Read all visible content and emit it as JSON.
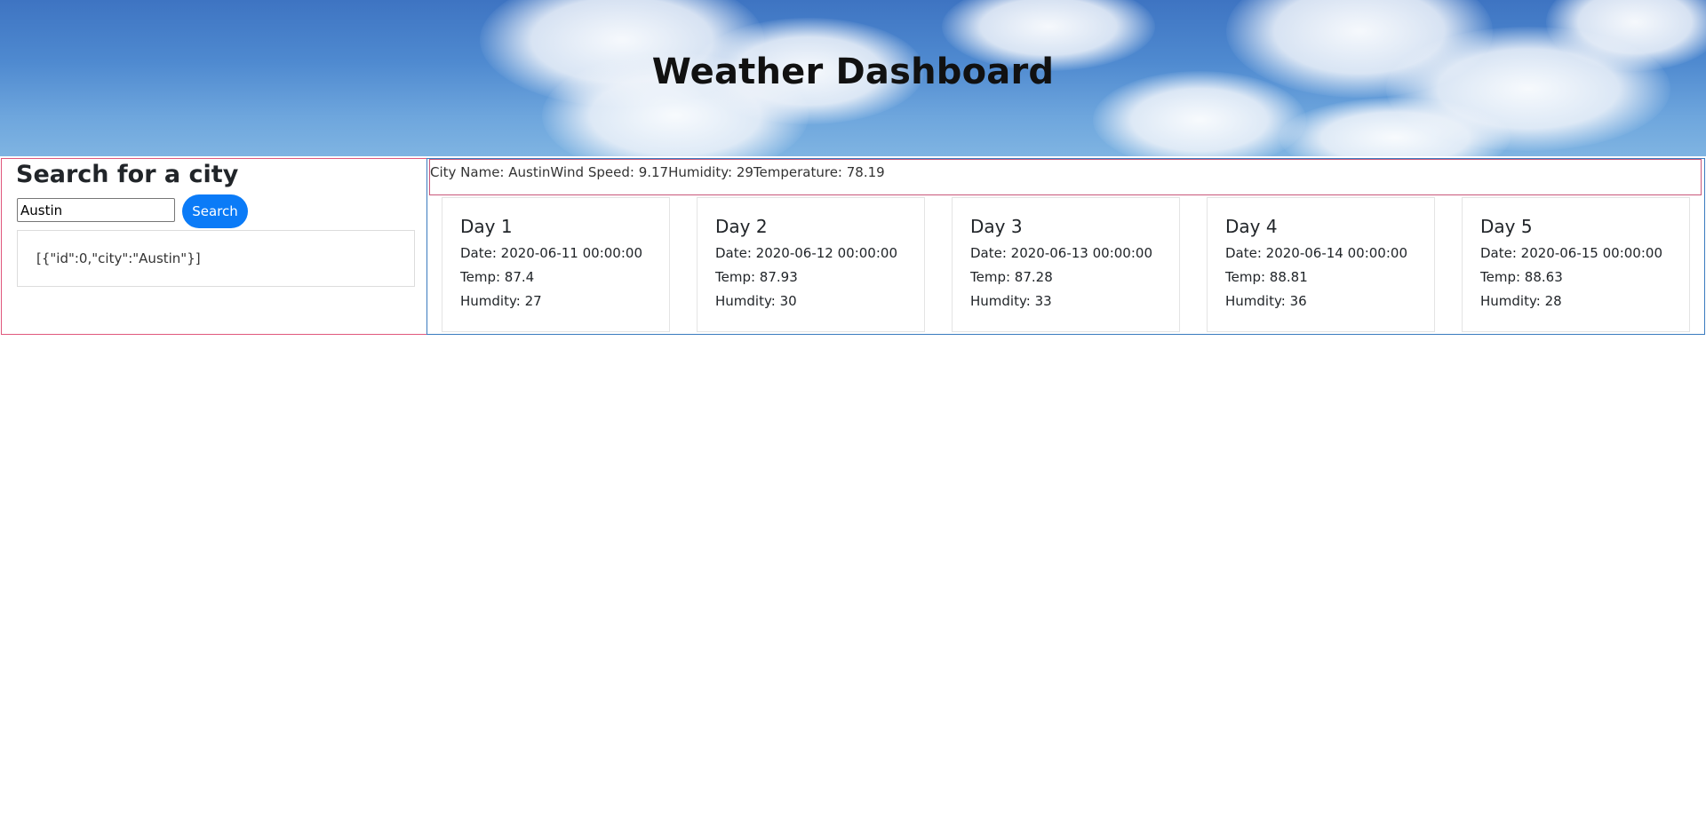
{
  "header": {
    "title": "Weather Dashboard"
  },
  "search": {
    "title": "Search for a city",
    "input_value": "Austin",
    "button_label": "Search",
    "history": "[{\"id\":0,\"city\":\"Austin\"}]"
  },
  "current": {
    "line": "City Name: AustinWind Speed: 9.17Humidity: 29Temperature: 78.19"
  },
  "forecast": {
    "days": [
      {
        "title": "Day 1",
        "date": "Date: 2020-06-11 00:00:00",
        "temp": "Temp: 87.4",
        "humidity": "Humdity: 27"
      },
      {
        "title": "Day 2",
        "date": "Date: 2020-06-12 00:00:00",
        "temp": "Temp: 87.93",
        "humidity": "Humdity: 30"
      },
      {
        "title": "Day 3",
        "date": "Date: 2020-06-13 00:00:00",
        "temp": "Temp: 87.28",
        "humidity": "Humdity: 33"
      },
      {
        "title": "Day 4",
        "date": "Date: 2020-06-14 00:00:00",
        "temp": "Temp: 88.81",
        "humidity": "Humdity: 36"
      },
      {
        "title": "Day 5",
        "date": "Date: 2020-06-15 00:00:00",
        "temp": "Temp: 88.63",
        "humidity": "Humdity: 28"
      }
    ]
  },
  "colors": {
    "accent_button": "#0b7bf7",
    "left_border": "#e0577c",
    "right_border": "#3a7bbf",
    "sky_top": "#3e74c2",
    "sky_bottom": "#7fb4e2"
  }
}
